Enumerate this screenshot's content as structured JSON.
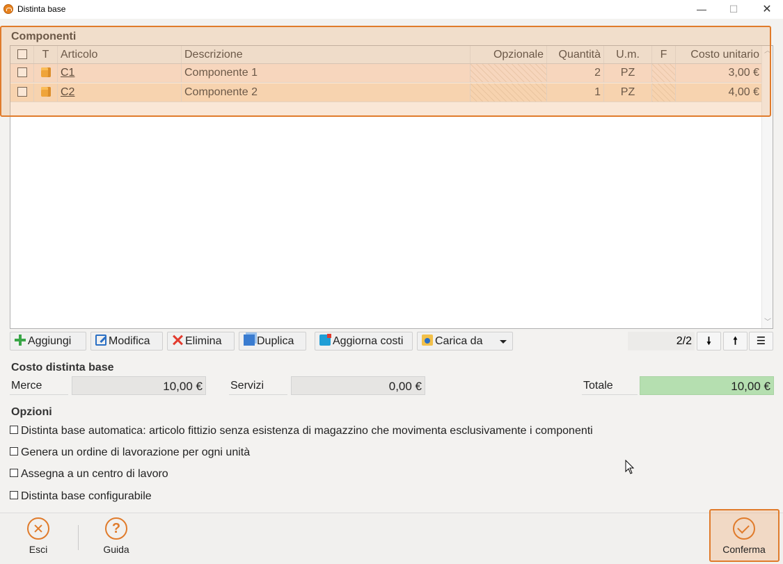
{
  "window": {
    "title": "Distinta base",
    "minimize_glyph": "—",
    "maximize_glyph": "☐",
    "close_glyph": "✕"
  },
  "components": {
    "section_title": "Componenti",
    "columns": {
      "type": "T",
      "article": "Articolo",
      "description": "Descrizione",
      "optional": "Opzionale",
      "quantity": "Quantità",
      "unit": "U.m.",
      "f": "F",
      "unit_cost": "Costo unitario"
    },
    "rows": [
      {
        "article": "C1",
        "description": "Componente 1",
        "optional": "",
        "quantity": "2",
        "unit": "PZ",
        "f": "",
        "unit_cost": "3,00 €"
      },
      {
        "article": "C2",
        "description": "Componente 2",
        "optional": "",
        "quantity": "1",
        "unit": "PZ",
        "f": "",
        "unit_cost": "4,00 €"
      }
    ],
    "toolbar": {
      "add": "Aggiungi",
      "edit": "Modifica",
      "delete": "Elimina",
      "duplicate": "Duplica",
      "update_costs": "Aggiorna costi",
      "load_from": "Carica da"
    },
    "record_counter": "2/2"
  },
  "cost": {
    "section_title": "Costo distinta base",
    "goods_label": "Merce",
    "goods_value": "10,00 €",
    "services_label": "Servizi",
    "services_value": "0,00 €",
    "total_label": "Totale",
    "total_value": "10,00 €"
  },
  "options": {
    "section_title": "Opzioni",
    "items": [
      "Distinta base automatica: articolo fittizio senza esistenza di magazzino che movimenta esclusivamente i componenti",
      "Genera un ordine di lavorazione per ogni unità",
      "Assegna a un centro di lavoro",
      "Distinta base configurabile"
    ]
  },
  "footer": {
    "exit": "Esci",
    "help": "Guida",
    "help_glyph": "?",
    "confirm": "Conferma"
  },
  "colors": {
    "accent": "#e07b2b",
    "total_bg": "#b5dfb0",
    "row1_bg": "#fbe7dc",
    "row2_bg": "#fbe3c8"
  }
}
